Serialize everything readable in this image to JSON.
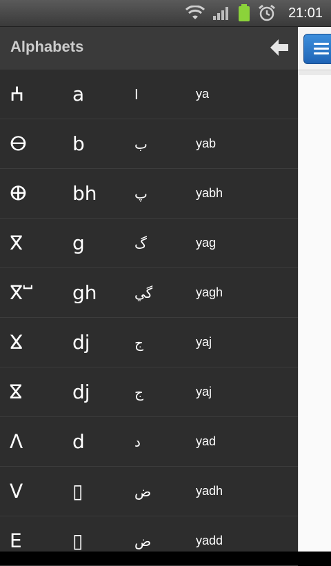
{
  "status": {
    "time": "21:01",
    "battery_color": "#8bd33a"
  },
  "drawer": {
    "title": "Alphabets"
  },
  "alphabet": [
    {
      "tifinagh": "ⵄ",
      "latin": "a",
      "arabic": "ا",
      "name": "ya"
    },
    {
      "tifinagh": "ⴱ",
      "latin": "b",
      "arabic": "ب",
      "name": "yab"
    },
    {
      "tifinagh": "ⴲ",
      "latin": "bh",
      "arabic": "پ",
      "name": "yabh"
    },
    {
      "tifinagh": "ⴳ",
      "latin": "g",
      "arabic": "گ",
      "name": "yag"
    },
    {
      "tifinagh": "ⴳⵯ",
      "latin": "gh",
      "arabic": "گي",
      "name": "yagh"
    },
    {
      "tifinagh": "ⴴ",
      "latin": "dj",
      "arabic": "ج",
      "name": "yaj"
    },
    {
      "tifinagh": "ⴵ",
      "latin": "dj",
      "arabic": "ج",
      "name": "yaj"
    },
    {
      "tifinagh": "ⴷ",
      "latin": "d",
      "arabic": "د",
      "name": "yad"
    },
    {
      "tifinagh": "ⴸ",
      "latin": "▯",
      "arabic": "ض",
      "name": "yadh"
    },
    {
      "tifinagh": "ⴹ",
      "latin": "▯",
      "arabic": "ض",
      "name": "yadd"
    }
  ]
}
